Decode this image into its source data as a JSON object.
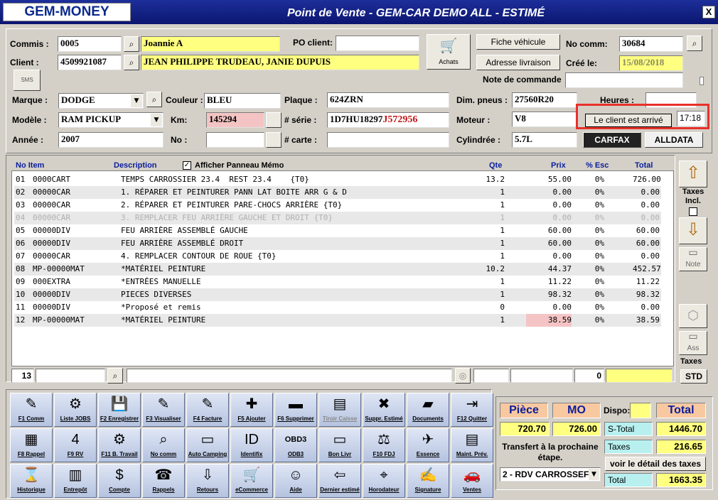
{
  "app": {
    "logo": "GEM-MONEY",
    "title": "Point de Vente - GEM-CAR DEMO ALL  - ESTIMÉ",
    "close": "X"
  },
  "header": {
    "commis_label": "Commis :",
    "commis_code": "0005",
    "commis_name": "Joannie A",
    "client_label": "Client :",
    "client_code": "4509921087",
    "client_name": "JEAN PHILIPPE TRUDEAU, JANIE DUPUIS",
    "po_label": "PO client:",
    "po_value": "",
    "achats_label": "Achats",
    "sms_label": "SMS",
    "fiche_vehicule": "Fiche véhicule",
    "adresse_livraison": "Adresse livraison",
    "no_comm_label": "No comm:",
    "no_comm_value": "30684",
    "cree_label": "Créé le:",
    "cree_value": "15/08/2018",
    "note_label": "Note de commande",
    "note_value": ""
  },
  "vehicle": {
    "marque_label": "Marque :",
    "marque": "DODGE",
    "modele_label": "Modèle :",
    "modele": "RAM PICKUP",
    "annee_label": "Année :",
    "annee": "2007",
    "couleur_label": "Couleur :",
    "couleur": "BLEU",
    "km_label": "Km:",
    "km": "145294",
    "no_label": "No :",
    "no_value": "",
    "plaque_label": "Plaque :",
    "plaque": "624ZRN",
    "serie_label": "# série :",
    "serie_a": "1D7HU18297",
    "serie_b": "J572956",
    "carte_label": "# carte :",
    "carte": "",
    "pneus_label": "Dim. pneus :",
    "pneus": "27560R20",
    "moteur_label": "Moteur :",
    "moteur": "V8",
    "cyl_label": "Cylindrée :",
    "cyl": "5.7L",
    "heures_label": "Heures :",
    "heures": "",
    "client_arrive": "Le client est arrivé",
    "arrive_time": "17:18",
    "carfax": "CARFAX",
    "alldata": "ALLDATA"
  },
  "table": {
    "headers": {
      "no_item": "No Item",
      "description": "Description",
      "memo": "Afficher Panneau Mémo",
      "qte": "Qte",
      "prix": "Prix",
      "esc": "% Esc",
      "total": "Total"
    },
    "rows": [
      {
        "n": "01",
        "item": "0000CART",
        "desc": "TEMPS CARROSSIER 23.4  REST 23.4    {T0}",
        "qte": "13.2",
        "prix": "55.00",
        "esc": "0%",
        "total": "726.00"
      },
      {
        "n": "02",
        "item": "00000CAR",
        "desc": "1. RÉPARER ET PEINTURER PANN LAT BOITE ARR G & D",
        "qte": "1",
        "prix": "0.00",
        "esc": "0%",
        "total": "0.00"
      },
      {
        "n": "03",
        "item": "00000CAR",
        "desc": "2. RÉPARER ET PEINTURER PARE-CHOCS ARRIÈRE {T0}",
        "qte": "1",
        "prix": "0.00",
        "esc": "0%",
        "total": "0.00"
      },
      {
        "n": "04",
        "item": "00000CAR",
        "desc": "3. REMPLACER FEU ARRIÈRE GAUCHE ET DROIT {T0}",
        "qte": "1",
        "prix": "0.00",
        "esc": "0%",
        "total": "0.00"
      },
      {
        "n": "05",
        "item": "00000DIV",
        "desc": "FEU ARRIÈRE ASSEMBLÉ GAUCHE",
        "qte": "1",
        "prix": "60.00",
        "esc": "0%",
        "total": "60.00"
      },
      {
        "n": "06",
        "item": "00000DIV",
        "desc": "FEU ARRIÈRE ASSEMBLÉ DROIT",
        "qte": "1",
        "prix": "60.00",
        "esc": "0%",
        "total": "60.00"
      },
      {
        "n": "07",
        "item": "00000CAR",
        "desc": "4. REMPLACER CONTOUR DE ROUE {T0}",
        "qte": "1",
        "prix": "0.00",
        "esc": "0%",
        "total": "0.00"
      },
      {
        "n": "08",
        "item": "MP-00000MAT",
        "desc": "*MATÉRIEL PEINTURE",
        "qte": "10.2",
        "prix": "44.37",
        "esc": "0%",
        "total": "452.57"
      },
      {
        "n": "09",
        "item": "000EXTRA",
        "desc": "*ENTRÉES MANUELLE",
        "qte": "1",
        "prix": "11.22",
        "esc": "0%",
        "total": "11.22"
      },
      {
        "n": "10",
        "item": "00000DIV",
        "desc": "PIECES DIVERSES",
        "qte": "1",
        "prix": "98.32",
        "esc": "0%",
        "total": "98.32"
      },
      {
        "n": "11",
        "item": "00000DIV",
        "desc": "*Proposé et remis",
        "qte": "0",
        "prix": "0.00",
        "esc": "0%",
        "total": "0.00"
      },
      {
        "n": "12",
        "item": "MP-00000MAT",
        "desc": "*MATÉRIEL PEINTURE",
        "qte": "1",
        "prix": "38.59",
        "esc": "0%",
        "total": "38.59"
      }
    ],
    "entry_no": "13",
    "entry_qty": "0"
  },
  "side": {
    "taxes_incl": "Taxes Incl.",
    "note": "Note",
    "ass": "Ass",
    "taxes": "Taxes",
    "std": "STD"
  },
  "fkeys": [
    [
      {
        "l": "F1 Comm",
        "i": "✎"
      },
      {
        "l": "Liste JOBS",
        "i": "⚙"
      },
      {
        "l": "F2 Enregistrer",
        "i": "💾"
      },
      {
        "l": "F3 Visualiser",
        "i": "✎"
      },
      {
        "l": "F4 Facture",
        "i": "✎"
      },
      {
        "l": "F5 Ajouter",
        "i": "✚"
      },
      {
        "l": "F6 Supprimer",
        "i": "▬"
      },
      {
        "l": "Tiroir Caisse",
        "i": "▤",
        "d": true
      },
      {
        "l": "Suppr. Estimé",
        "i": "✖"
      },
      {
        "l": "Documents",
        "i": "▰"
      },
      {
        "l": "F12 Quitter",
        "i": "⇥"
      }
    ],
    [
      {
        "l": "F8 Rappel",
        "i": "▦"
      },
      {
        "l": "F9 RV",
        "i": "4"
      },
      {
        "l": "F11 B. Travail",
        "i": "⚙"
      },
      {
        "l": "No comm",
        "i": "⌕"
      },
      {
        "l": "Auto Camping",
        "i": "▭"
      },
      {
        "l": "Identifix",
        "i": "ID"
      },
      {
        "l": "ODB3",
        "i": "OBD3"
      },
      {
        "l": "Bon Livr",
        "i": "▭"
      },
      {
        "l": "F10 FDJ",
        "i": "⚖"
      },
      {
        "l": "Essence",
        "i": "✈"
      },
      {
        "l": "Maint. Prév.",
        "i": "▤"
      }
    ],
    [
      {
        "l": "Historique",
        "i": "⌛"
      },
      {
        "l": "Entrepôt",
        "i": "▥"
      },
      {
        "l": "Compte",
        "i": "$"
      },
      {
        "l": "Rappels",
        "i": "☎"
      },
      {
        "l": "Retours",
        "i": "⇩"
      },
      {
        "l": "eCommerce",
        "i": "🛒"
      },
      {
        "l": "Aide",
        "i": "☺"
      },
      {
        "l": "Dernier estimé",
        "i": "⇦"
      },
      {
        "l": "Horodateur",
        "i": "⌖"
      },
      {
        "l": "Signature",
        "i": "✍"
      },
      {
        "l": "Ventes",
        "i": "🚗"
      }
    ]
  ],
  "totals": {
    "piece_label": "Pièce",
    "mo_label": "MO",
    "dispo_label": "Dispo:",
    "total_label": "Total",
    "piece": "720.70",
    "mo": "726.00",
    "stotal_label": "S-Total",
    "stotal": "1446.70",
    "transfert": "Transfert à la prochaine étape.",
    "taxes_label": "Taxes",
    "taxes": "216.65",
    "detail_taxes": "voir le détail des taxes",
    "stage": "2 - RDV CARROSSEF",
    "grand_label": "Total",
    "grand": "1663.35"
  }
}
